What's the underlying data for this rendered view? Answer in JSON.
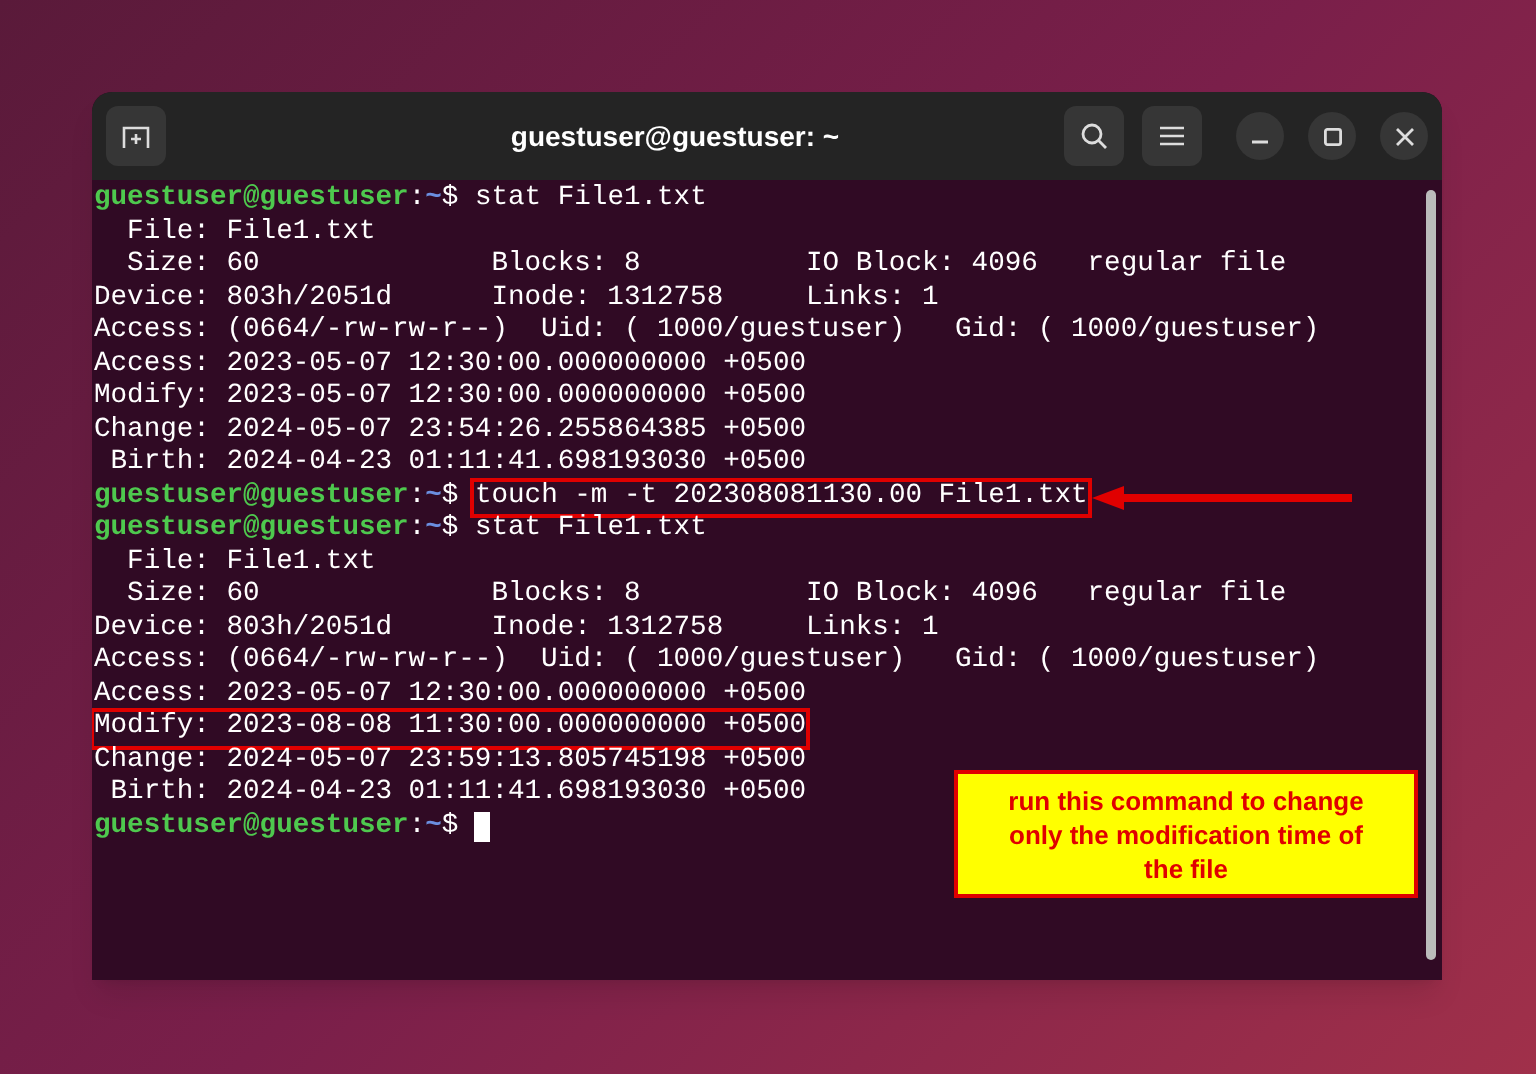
{
  "window": {
    "title": "guestuser@guestuser: ~"
  },
  "terminal": {
    "lines": [
      {
        "kind": "prompt",
        "user": "guestuser@guestuser",
        "separator": ":",
        "path": "~",
        "symbol": "$",
        "command": "stat File1.txt"
      },
      {
        "kind": "output",
        "text": "  File: File1.txt"
      },
      {
        "kind": "output",
        "text": "  Size: 60              Blocks: 8          IO Block: 4096   regular file"
      },
      {
        "kind": "output",
        "text": "Device: 803h/2051d      Inode: 1312758     Links: 1"
      },
      {
        "kind": "output",
        "text": "Access: (0664/-rw-rw-r--)  Uid: ( 1000/guestuser)   Gid: ( 1000/guestuser)"
      },
      {
        "kind": "output",
        "text": "Access: 2023-05-07 12:30:00.000000000 +0500"
      },
      {
        "kind": "output",
        "text": "Modify: 2023-05-07 12:30:00.000000000 +0500"
      },
      {
        "kind": "output",
        "text": "Change: 2024-05-07 23:54:26.255864385 +0500"
      },
      {
        "kind": "output",
        "text": " Birth: 2024-04-23 01:11:41.698193030 +0500"
      },
      {
        "kind": "prompt",
        "user": "guestuser@guestuser",
        "separator": ":",
        "path": "~",
        "symbol": "$",
        "command": "touch -m -t 202308081130.00 File1.txt",
        "highlighted": true
      },
      {
        "kind": "prompt",
        "user": "guestuser@guestuser",
        "separator": ":",
        "path": "~",
        "symbol": "$",
        "command": "stat File1.txt"
      },
      {
        "kind": "output",
        "text": "  File: File1.txt"
      },
      {
        "kind": "output",
        "text": "  Size: 60              Blocks: 8          IO Block: 4096   regular file"
      },
      {
        "kind": "output",
        "text": "Device: 803h/2051d      Inode: 1312758     Links: 1"
      },
      {
        "kind": "output",
        "text": "Access: (0664/-rw-rw-r--)  Uid: ( 1000/guestuser)   Gid: ( 1000/guestuser)"
      },
      {
        "kind": "output",
        "text": "Access: 2023-05-07 12:30:00.000000000 +0500"
      },
      {
        "kind": "output",
        "text": "Modify: 2023-08-08 11:30:00.000000000 +0500",
        "highlighted": true
      },
      {
        "kind": "output",
        "text": "Change: 2024-05-07 23:59:13.805745198 +0500"
      },
      {
        "kind": "output",
        "text": " Birth: 2024-04-23 01:11:41.698193030 +0500"
      },
      {
        "kind": "prompt",
        "user": "guestuser@guestuser",
        "separator": ":",
        "path": "~",
        "symbol": "$",
        "cursor": true
      }
    ]
  },
  "callout": {
    "text": "run this command to change only the modification time of the file"
  }
}
